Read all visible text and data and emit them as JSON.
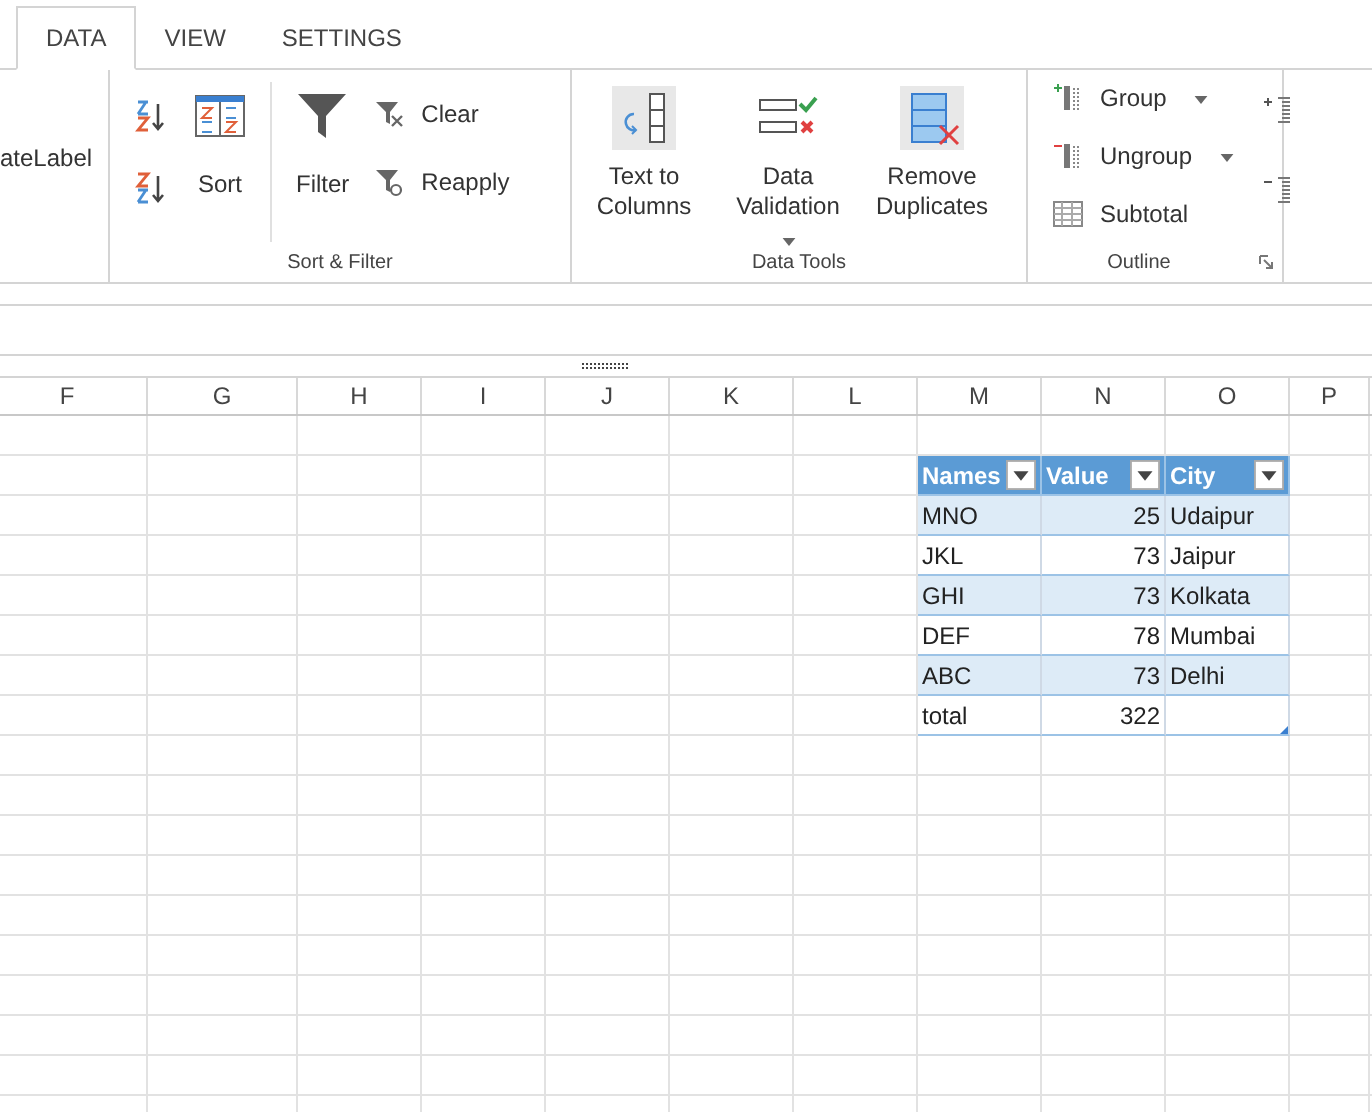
{
  "tabs": [
    {
      "label": "DATA",
      "selected": true
    },
    {
      "label": "VIEW",
      "selected": false
    },
    {
      "label": "SETTINGS",
      "selected": false
    }
  ],
  "ribbon": {
    "cut_label": "ateLabel",
    "sort_filter": {
      "label": "Sort & Filter",
      "sort": "Sort",
      "filter": "Filter",
      "clear": "Clear",
      "reapply": "Reapply"
    },
    "data_tools": {
      "label": "Data Tools",
      "buttons": [
        {
          "label": "Text to Columns",
          "dropdown": false
        },
        {
          "label": "Data Validation",
          "dropdown": true
        },
        {
          "label": "Remove Duplicates",
          "dropdown": false
        }
      ]
    },
    "outline": {
      "label": "Outline",
      "buttons": [
        {
          "label": "Group",
          "dropdown": true
        },
        {
          "label": "Ungroup",
          "dropdown": true
        },
        {
          "label": "Subtotal",
          "dropdown": false
        }
      ]
    }
  },
  "sheet": {
    "columns": [
      "F",
      "G",
      "H",
      "I",
      "J",
      "K",
      "L",
      "M",
      "N",
      "O",
      "P"
    ],
    "table": {
      "headers": [
        {
          "label": "Names",
          "filter": true
        },
        {
          "label": "Value",
          "filter": true
        },
        {
          "label": "City",
          "filter": true
        }
      ],
      "rows": [
        {
          "banded": true,
          "cells": [
            "MNO",
            "25",
            "Udaipur"
          ]
        },
        {
          "banded": false,
          "cells": [
            "JKL",
            "73",
            "Jaipur"
          ]
        },
        {
          "banded": true,
          "cells": [
            "GHI",
            "73",
            "Kolkata"
          ]
        },
        {
          "banded": false,
          "cells": [
            "DEF",
            "78",
            "Mumbai"
          ]
        },
        {
          "banded": true,
          "cells": [
            "ABC",
            "73",
            "Delhi"
          ]
        },
        {
          "banded": false,
          "cells": [
            "total",
            "322"
          ]
        }
      ]
    }
  }
}
